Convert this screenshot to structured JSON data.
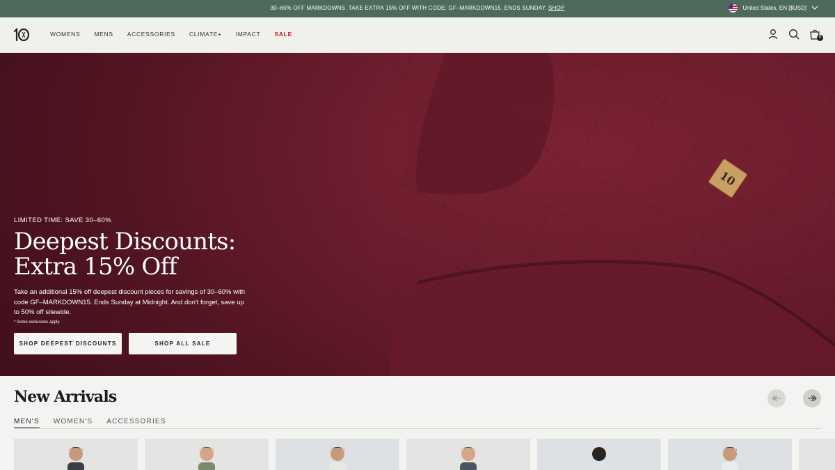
{
  "announcement": {
    "text": "30–60% OFF MARKDOWNS. TAKE EXTRA 15% OFF WITH CODE: GF–MARKDOWN15. ENDS SUNDAY. ",
    "link": "SHOP"
  },
  "locale": {
    "label": "United States, EN [$USD]",
    "icon": "us-flag-icon"
  },
  "header": {
    "logo": "10",
    "nav": [
      "WOMENS",
      "MENS",
      "ACCESSORIES",
      "CLIMATE+",
      "IMPACT",
      "SALE"
    ],
    "cart_count": "0",
    "icons": [
      "account-icon",
      "search-icon",
      "cart-icon"
    ]
  },
  "hero": {
    "eyebrow": "LIMITED TIME: SAVE 30–60%",
    "title_line1": "Deepest Discounts:",
    "title_line2": "Extra 15% Off",
    "body": "Take an additional 15% off deepest discount pieces for savings of 30–60% with code GF–MARKDOWN15. Ends Sunday at Midnight. And don't forget, save up to 50% off sitewide.",
    "note": "* Some exclusions apply.",
    "patch_text": "10",
    "buttons": [
      "SHOP DEEPEST DISCOUNTS",
      "SHOP ALL SALE"
    ],
    "colors": {
      "fabric": "#6a1c2c",
      "patch": "#c9a063"
    }
  },
  "new_arrivals": {
    "title": "New Arrivals",
    "tabs": [
      "MEN'S",
      "WOMEN'S",
      "ACCESSORIES"
    ],
    "active_tab": "MEN'S",
    "arrows": [
      "arrow-left-icon",
      "arrow-right-icon"
    ]
  },
  "colors": {
    "announce_bg": "#4e6a5c",
    "sale": "#c01f26",
    "header_bg": "#f0f0ec"
  }
}
